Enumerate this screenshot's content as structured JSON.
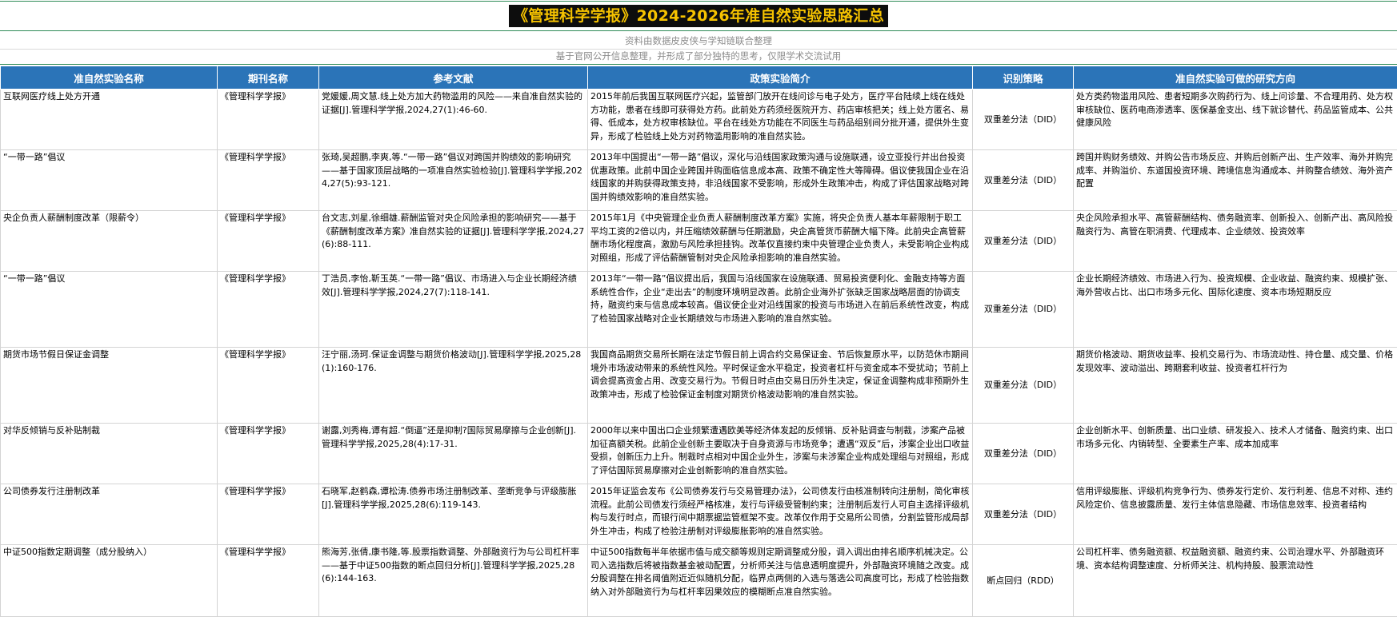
{
  "title": "《管理科学学报》2024-2026年准自然实验思路汇总",
  "subtitle": "资料由数据皮皮侠与学知链联合整理",
  "note": "基于官网公开信息整理，并形成了部分独特的思考，仅限学术交流试用",
  "colors": {
    "header_bg": "#2b74b8",
    "title_bg": "#0d0d0d",
    "title_text": "#f5c200",
    "rule_green": "#2e8b57"
  },
  "headers": [
    "准自然实验名称",
    "期刊名称",
    "参考文献",
    "政策实验简介",
    "识别策略",
    "准自然实验可做的研究方向"
  ],
  "rows": [
    {
      "name": "互联网医疗线上处方开通",
      "journal": "《管理科学学报》",
      "reference": "党媛媛,周文慧.线上处方加大药物滥用的风险——来自准自然实验的证据[J].管理科学学报,2024,27(1):46-60.",
      "intro": "2015年前后我国互联网医疗兴起，监管部门放开在线问诊与电子处方，医疗平台陆续上线在线处方功能，患者在线即可获得处方药。此前处方药须经医院开方、药店审核把关；线上处方匿名、易得、低成本，处方权审核缺位。平台在线处方功能在不同医生与药品组别间分批开通，提供外生变异，形成了检验线上处方对药物滥用影响的准自然实验。",
      "method": "双重差分法（DID）",
      "directions": "处方类药物滥用风险、患者短期多次购药行为、线上问诊量、不合理用药、处方权审核缺位、医药电商渗透率、医保基金支出、线下就诊替代、药品监管成本、公共健康风险"
    },
    {
      "name": "“一带一路”倡议",
      "journal": "《管理科学学报》",
      "reference": "张琦,吴超鹏,李爽,等.“一带一路”倡议对跨国并购绩效的影响研究——基于国家顶层战略的一项准自然实验检验[J].管理科学学报,2024,27(5):93-121.",
      "intro": "2013年中国提出“一带一路”倡议，深化与沿线国家政策沟通与设施联通，设立亚投行并出台投资优惠政策。此前中国企业跨国并购面临信息成本高、政策不确定性大等障碍。倡议使我国企业在沿线国家的并购获得政策支持，非沿线国家不受影响，形成外生政策冲击，构成了评估国家战略对跨国并购绩效影响的准自然实验。",
      "method": "双重差分法（DID）",
      "directions": "跨国并购财务绩效、并购公告市场反应、并购后创新产出、生产效率、海外并购完成率、并购溢价、东道国投资环境、跨境信息沟通成本、并购整合绩效、海外资产配置"
    },
    {
      "name": "央企负责人薪酬制度改革（限薪令）",
      "journal": "《管理科学学报》",
      "reference": "台文志,刘星,徐细雄.薪酬监管对央企风险承担的影响研究——基于《薪酬制度改革方案》准自然实验的证据[J].管理科学学报,2024,27(6):88-111.",
      "intro": "2015年1月《中央管理企业负责人薪酬制度改革方案》实施，将央企负责人基本年薪限制于职工平均工资的2倍以内，并压缩绩效薪酬与任期激励，央企高管货币薪酬大幅下降。此前央企高管薪酬市场化程度高，激励与风险承担挂钩。改革仅直接约束中央管理企业负责人，未受影响企业构成对照组，形成了评估薪酬管制对央企风险承担影响的准自然实验。",
      "method": "双重差分法（DID）",
      "directions": "央企风险承担水平、高管薪酬结构、债务融资率、创新投入、创新产出、高风险投融资行为、高管在职消费、代理成本、企业绩效、投资效率"
    },
    {
      "name": "“一带一路”倡议",
      "journal": "《管理科学学报》",
      "reference": "丁浩员,李怡,靳玉英.“一带一路”倡议、市场进入与企业长期经济绩效[J].管理科学学报,2024,27(7):118-141.",
      "intro": "2013年“一带一路”倡议提出后，我国与沿线国家在设施联通、贸易投资便利化、金融支持等方面系统性合作，企业“走出去”的制度环境明显改善。此前企业海外扩张缺乏国家战略层面的协调支持，融资约束与信息成本较高。倡议使企业对沿线国家的投资与市场进入在前后系统性改变，构成了检验国家战略对企业长期绩效与市场进入影响的准自然实验。",
      "method": "双重差分法（DID）",
      "directions": "企业长期经济绩效、市场进入行为、投资规模、企业收益、融资约束、规模扩张、海外营收占比、出口市场多元化、国际化速度、资本市场短期反应"
    },
    {
      "name": "期货市场节假日保证金调整",
      "journal": "《管理科学学报》",
      "reference": "汪宁丽,汤珂.保证金调整与期货价格波动[J].管理科学学报,2025,28(1):160-176.",
      "intro": "我国商品期货交易所长期在法定节假日前上调合约交易保证金、节后恢复原水平，以防范休市期间境外市场波动带来的系统性风险。平时保证金水平稳定，投资者杠杆与资金成本不受扰动；节前上调会提高资金占用、改变交易行为。节假日时点由交易日历外生决定，保证金调整构成非预期外生政策冲击，形成了检验保证金制度对期货价格波动影响的准自然实验。",
      "method": "双重差分法（DID）",
      "directions": "期货价格波动、期货收益率、投机交易行为、市场流动性、持仓量、成交量、价格发现效率、波动溢出、跨期套利收益、投资者杠杆行为"
    },
    {
      "name": "对华反倾销与反补贴制裁",
      "journal": "《管理科学学报》",
      "reference": "谢露,刘秀梅,谭有超.“倒逼”还是抑制?国际贸易摩擦与企业创新[J].管理科学学报,2025,28(4):17-31.",
      "intro": "2000年以来中国出口企业频繁遭遇欧美等经济体发起的反倾销、反补贴调查与制裁，涉案产品被加征高额关税。此前企业创新主要取决于自身资源与市场竞争；遭遇“双反”后，涉案企业出口收益受损，创新压力上升。制裁时点相对中国企业外生，涉案与未涉案企业构成处理组与对照组，形成了评估国际贸易摩擦对企业创新影响的准自然实验。",
      "method": "双重差分法（DID）",
      "directions": "企业创新水平、创新质量、出口业绩、研发投入、技术人才储备、融资约束、出口市场多元化、内销转型、全要素生产率、成本加成率"
    },
    {
      "name": "公司债券发行注册制改革",
      "journal": "《管理科学学报》",
      "reference": "石晓军,赵鹤森,谭松涛.债券市场注册制改革、垄断竞争与评级膨胀[J].管理科学学报,2025,28(6):119-143.",
      "intro": "2015年证监会发布《公司债券发行与交易管理办法》，公司债发行由核准制转向注册制，简化审核流程。此前公司债发行须经严格核准，发行与评级受管制约束；注册制后发行人可自主选择评级机构与发行时点，而银行间中期票据监管框架不变。改革仅作用于交易所公司债，分割监管形成局部外生冲击，构成了检验注册制对评级膨胀影响的准自然实验。",
      "method": "双重差分法（DID）",
      "directions": "信用评级膨胀、评级机构竞争行为、债券发行定价、发行利差、信息不对称、违约风险定价、信息披露质量、发行主体信息隐藏、市场信息效率、投资者结构"
    },
    {
      "name": "中证500指数定期调整（成分股纳入）",
      "journal": "《管理科学学报》",
      "reference": "熊海芳,张倩,康书隆,等.股票指数调整、外部融资行为与公司杠杆率——基于中证500指数的断点回归分析[J].管理科学学报,2025,28(6):144-163.",
      "intro": "中证500指数每半年依据市值与成交额等规则定期调整成分股，调入调出由排名顺序机械决定。公司入选指数后将被指数基金被动配置，分析师关注与信息透明度提升，外部融资环境随之改变。成分股调整在排名阈值附近近似随机分配，临界点两侧的入选与落选公司高度可比，形成了检验指数纳入对外部融资行为与杠杆率因果效应的模糊断点准自然实验。",
      "method": "断点回归（RDD）",
      "directions": "公司杠杆率、债务融资额、权益融资额、融资约束、公司治理水平、外部融资环境、资本结构调整速度、分析师关注、机构持股、股票流动性"
    }
  ]
}
